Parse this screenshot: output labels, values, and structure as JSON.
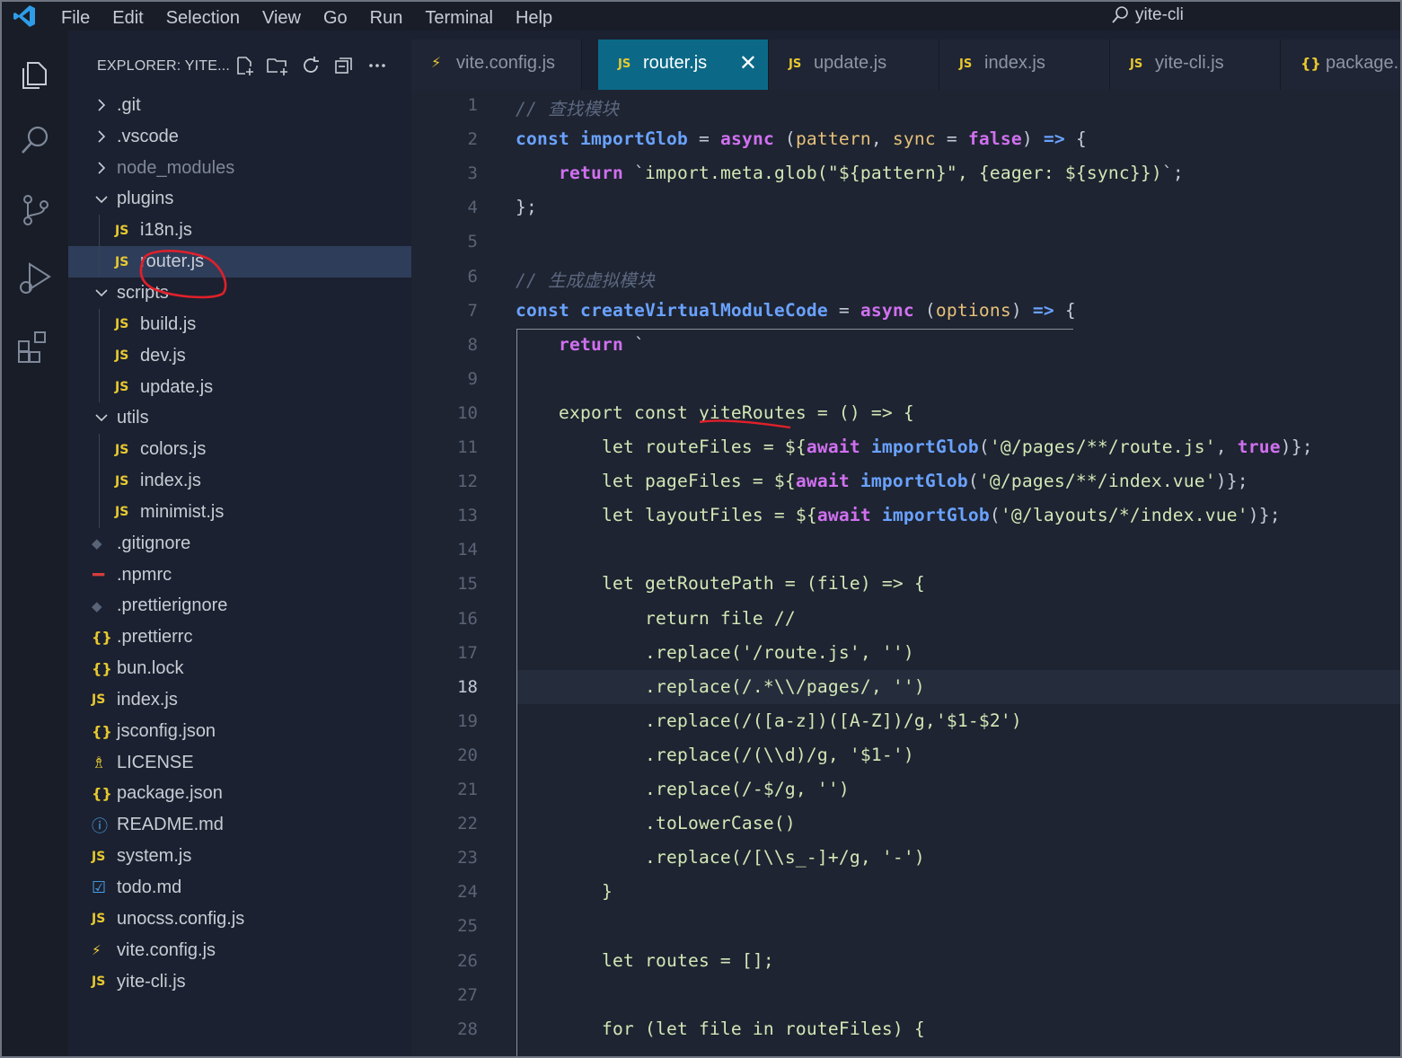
{
  "titlebar": {
    "menu": [
      "File",
      "Edit",
      "Selection",
      "View",
      "Go",
      "Run",
      "Terminal",
      "Help"
    ],
    "search": "yite-cli"
  },
  "sidebar": {
    "title": "EXPLORER: YITE...",
    "tree": [
      {
        "label": ".git",
        "type": "folder",
        "open": false,
        "depth": 0
      },
      {
        "label": ".vscode",
        "type": "folder",
        "open": false,
        "depth": 0
      },
      {
        "label": "node_modules",
        "type": "folder",
        "open": false,
        "depth": 0,
        "dim": true
      },
      {
        "label": "plugins",
        "type": "folder",
        "open": true,
        "depth": 0
      },
      {
        "label": "i18n.js",
        "type": "js",
        "depth": 1
      },
      {
        "label": "router.js",
        "type": "js",
        "depth": 1,
        "active": true
      },
      {
        "label": "scripts",
        "type": "folder",
        "open": true,
        "depth": 0
      },
      {
        "label": "build.js",
        "type": "js",
        "depth": 1
      },
      {
        "label": "dev.js",
        "type": "js",
        "depth": 1
      },
      {
        "label": "update.js",
        "type": "js",
        "depth": 1
      },
      {
        "label": "utils",
        "type": "folder",
        "open": true,
        "depth": 0
      },
      {
        "label": "colors.js",
        "type": "js",
        "depth": 1
      },
      {
        "label": "index.js",
        "type": "js",
        "depth": 1
      },
      {
        "label": "minimist.js",
        "type": "js",
        "depth": 1
      },
      {
        "label": ".gitignore",
        "type": "git",
        "depth": 0
      },
      {
        "label": ".npmrc",
        "type": "npm",
        "depth": 0
      },
      {
        "label": ".prettierignore",
        "type": "git",
        "depth": 0
      },
      {
        "label": ".prettierrc",
        "type": "json",
        "depth": 0
      },
      {
        "label": "bun.lock",
        "type": "json",
        "depth": 0
      },
      {
        "label": "index.js",
        "type": "js",
        "depth": 0
      },
      {
        "label": "jsconfig.json",
        "type": "json",
        "depth": 0
      },
      {
        "label": "LICENSE",
        "type": "license",
        "depth": 0
      },
      {
        "label": "package.json",
        "type": "json",
        "depth": 0
      },
      {
        "label": "README.md",
        "type": "info",
        "depth": 0
      },
      {
        "label": "system.js",
        "type": "js",
        "depth": 0
      },
      {
        "label": "todo.md",
        "type": "todo",
        "depth": 0
      },
      {
        "label": "unocss.config.js",
        "type": "js",
        "depth": 0
      },
      {
        "label": "vite.config.js",
        "type": "vite",
        "depth": 0
      },
      {
        "label": "yite-cli.js",
        "type": "js",
        "depth": 0
      }
    ]
  },
  "tabs": [
    {
      "label": "vite.config.js",
      "icon": "vite",
      "active": false
    },
    {
      "label": "router.js",
      "icon": "js",
      "active": true
    },
    {
      "label": "update.js",
      "icon": "js",
      "active": false
    },
    {
      "label": "index.js",
      "icon": "js",
      "active": false
    },
    {
      "label": "yite-cli.js",
      "icon": "js",
      "active": false
    },
    {
      "label": "package.",
      "icon": "json",
      "active": false
    }
  ],
  "editor": {
    "current_line": 18,
    "lines": [
      [
        [
          "cmt",
          "// 查找模块"
        ]
      ],
      [
        [
          "kw",
          "const "
        ],
        [
          "fn",
          "importGlob"
        ],
        [
          "",
          " = "
        ],
        [
          "pur",
          "async"
        ],
        [
          "",
          " ("
        ],
        [
          "param",
          "pattern"
        ],
        [
          "",
          ", "
        ],
        [
          "param",
          "sync"
        ],
        [
          "",
          " = "
        ],
        [
          "pur",
          "false"
        ],
        [
          "",
          ") "
        ],
        [
          "kw",
          "=>"
        ],
        [
          "",
          " {"
        ]
      ],
      [
        [
          "",
          "    "
        ],
        [
          "pur",
          "return"
        ],
        [
          "",
          " `"
        ],
        [
          "str",
          "import.meta.glob(\"${pattern}\", {eager: ${sync}})"
        ],
        [
          "",
          "`;"
        ]
      ],
      [
        [
          "",
          "};"
        ]
      ],
      [
        [
          "",
          ""
        ]
      ],
      [
        [
          "cmt",
          "// 生成虚拟模块"
        ]
      ],
      [
        [
          "kw",
          "const "
        ],
        [
          "fn",
          "createVirtualModuleCode"
        ],
        [
          "",
          " = "
        ],
        [
          "pur",
          "async"
        ],
        [
          "",
          " ("
        ],
        [
          "param",
          "options"
        ],
        [
          "",
          ") "
        ],
        [
          "kw",
          "=>"
        ],
        [
          "",
          " {"
        ]
      ],
      [
        [
          "",
          "    "
        ],
        [
          "pur",
          "return"
        ],
        [
          "",
          " `"
        ]
      ],
      [
        [
          "",
          ""
        ]
      ],
      [
        [
          "str",
          "    export const yiteRoutes = () => {"
        ]
      ],
      [
        [
          "str",
          "        let routeFiles = ${"
        ],
        [
          "pur",
          "await"
        ],
        [
          "",
          " "
        ],
        [
          "fn",
          "importGlob"
        ],
        [
          "",
          "("
        ],
        [
          "str",
          "'@/pages/**/route.js'"
        ],
        [
          "",
          ", "
        ],
        [
          "pur",
          "true"
        ],
        [
          "",
          ")};"
        ]
      ],
      [
        [
          "str",
          "        let pageFiles = ${"
        ],
        [
          "pur",
          "await"
        ],
        [
          "",
          " "
        ],
        [
          "fn",
          "importGlob"
        ],
        [
          "",
          "("
        ],
        [
          "str",
          "'@/pages/**/index.vue'"
        ],
        [
          "",
          ")};"
        ]
      ],
      [
        [
          "str",
          "        let layoutFiles = ${"
        ],
        [
          "pur",
          "await"
        ],
        [
          "",
          " "
        ],
        [
          "fn",
          "importGlob"
        ],
        [
          "",
          "("
        ],
        [
          "str",
          "'@/layouts/*/index.vue'"
        ],
        [
          "",
          ")};"
        ]
      ],
      [
        [
          "",
          ""
        ]
      ],
      [
        [
          "str",
          "        let getRoutePath = (file) => {"
        ]
      ],
      [
        [
          "str",
          "            return file //"
        ]
      ],
      [
        [
          "str",
          "            .replace('/route.js', '')"
        ]
      ],
      [
        [
          "str",
          "            .replace(/.*\\\\/pages/, '')"
        ]
      ],
      [
        [
          "str",
          "            .replace(/([a-z])([A-Z])/g,'$1-$2')"
        ]
      ],
      [
        [
          "str",
          "            .replace(/(\\\\d)/g, '$1-')"
        ]
      ],
      [
        [
          "str",
          "            .replace(/-$/g, '')"
        ]
      ],
      [
        [
          "str",
          "            .toLowerCase()"
        ]
      ],
      [
        [
          "str",
          "            .replace(/[\\\\s_-]+/g, '-')"
        ]
      ],
      [
        [
          "str",
          "        }"
        ]
      ],
      [
        [
          "",
          ""
        ]
      ],
      [
        [
          "str",
          "        let routes = [];"
        ]
      ],
      [
        [
          "",
          ""
        ]
      ],
      [
        [
          "str",
          "        for (let file in routeFiles) {"
        ]
      ]
    ]
  }
}
